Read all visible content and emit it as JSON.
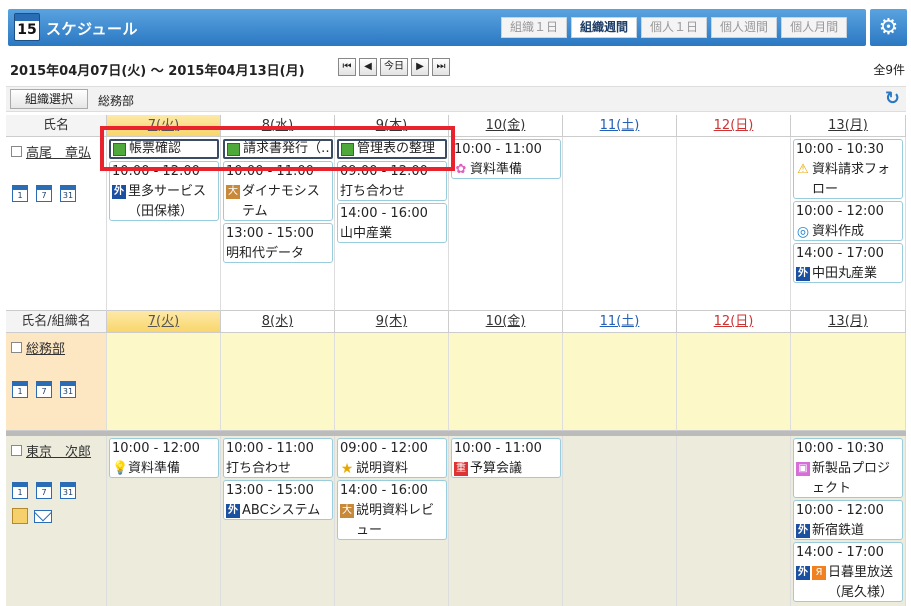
{
  "header": {
    "title": "スケジュール",
    "cal_icon_number": "15",
    "views": [
      {
        "label": "組織１日",
        "active": false
      },
      {
        "label": "組織週間",
        "active": true
      },
      {
        "label": "個人１日",
        "active": false
      },
      {
        "label": "個人週間",
        "active": false
      },
      {
        "label": "個人月間",
        "active": false
      }
    ],
    "settings_icon": "gear-icon"
  },
  "range": {
    "label": "2015年04月07日(火) ～ 2015年04月13日(月)",
    "nav": [
      "⏮",
      "◀",
      "今日",
      "▶",
      "⏭"
    ],
    "total": "全9件"
  },
  "org_bar": {
    "select_label": "組織選択",
    "org_name": "総務部"
  },
  "grid": {
    "name_header_1": "氏名",
    "name_header_2": "氏名/組織名",
    "days": [
      {
        "label": "7(火)",
        "kind": "today"
      },
      {
        "label": "8(水)",
        "kind": "normal"
      },
      {
        "label": "9(木)",
        "kind": "normal"
      },
      {
        "label": "10(金)",
        "kind": "normal"
      },
      {
        "label": "11(土)",
        "kind": "sat"
      },
      {
        "label": "12(日)",
        "kind": "sun"
      },
      {
        "label": "13(月)",
        "kind": "normal"
      }
    ],
    "mini_icons": [
      "1",
      "7",
      "31"
    ]
  },
  "person1": {
    "name": "高尾　章弘",
    "tasks": [
      "帳票確認",
      "請求書発行（…",
      "管理表の整理"
    ],
    "events": {
      "d7": [
        {
          "time": "10:00 - 12:00",
          "title": "里多サービス（田保様）",
          "icon": "gai"
        }
      ],
      "d8": [
        {
          "time": "10:00 - 11:00",
          "title": "ダイナモシステム",
          "icon": "bld"
        },
        {
          "time": "13:00 - 15:00",
          "title": "明和代データ",
          "icon": ""
        }
      ],
      "d9": [
        {
          "time": "09:00 - 12:00",
          "title": "打ち合わせ",
          "icon": ""
        },
        {
          "time": "14:00 - 16:00",
          "title": "山中産業",
          "icon": ""
        }
      ],
      "d10": [
        {
          "time": "10:00 - 11:00",
          "title": "資料準備",
          "icon": "flower"
        }
      ],
      "d13": [
        {
          "time": "10:00 - 10:30",
          "title": "資料請求フォロー",
          "icon": "warn"
        },
        {
          "time": "10:00 - 12:00",
          "title": "資料作成",
          "icon": "spiral"
        },
        {
          "time": "14:00 - 17:00",
          "title": "中田丸産業",
          "icon": "gai"
        }
      ]
    }
  },
  "org_row": {
    "name": "総務部"
  },
  "person2": {
    "name": "東京　次郎",
    "events": {
      "d7": [
        {
          "time": "10:00 - 12:00",
          "title": "資料準備",
          "icon": "bulb"
        }
      ],
      "d8": [
        {
          "time": "10:00 - 11:00",
          "title": "打ち合わせ",
          "icon": ""
        },
        {
          "time": "13:00 - 15:00",
          "title": "ABCシステム",
          "icon": "gai"
        }
      ],
      "d9": [
        {
          "time": "09:00 - 12:00",
          "title": "説明資料",
          "icon": "star"
        },
        {
          "time": "14:00 - 16:00",
          "title": "説明資料レビュー",
          "icon": "bld"
        }
      ],
      "d10": [
        {
          "time": "10:00 - 11:00",
          "title": "予算会議",
          "icon": "red"
        }
      ],
      "d13": [
        {
          "time": "10:00 - 10:30",
          "title": "新製品プロジェクト",
          "icon": "gift"
        },
        {
          "time": "10:00 - 12:00",
          "title": "新宿鉄道",
          "icon": "gai"
        },
        {
          "time": "14:00 - 17:00",
          "title": "日暮里放送（尾久様）",
          "icon": "gai2"
        }
      ]
    }
  },
  "labels": {
    "gai": "外",
    "bld": "大",
    "red": "重",
    "bulb": "💡",
    "star": "★",
    "warn": "⚠",
    "spiral": "◎",
    "flower": "✿",
    "gift": "▣",
    "orange": "Я"
  }
}
